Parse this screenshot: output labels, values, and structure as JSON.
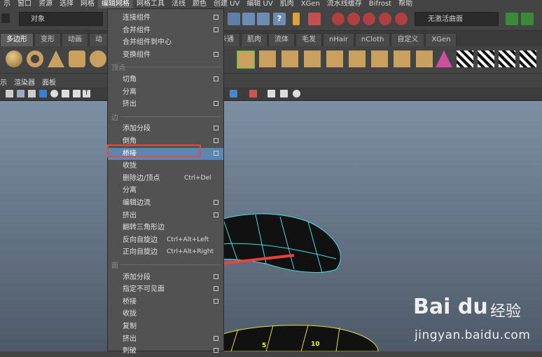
{
  "menubar": [
    "示",
    "窗口",
    "资源",
    "选择",
    "网格",
    "编辑网格",
    "网格工具",
    "法线",
    "颜色",
    "创建 UV",
    "编辑 UV",
    "肌肉",
    "XGen",
    "流水线缓存",
    "Bifrost",
    "帮助"
  ],
  "toolbar": {
    "object_mode": "对象",
    "smooth_mode": "无激活曲面"
  },
  "shelf_tabs": [
    "多边形",
    "变形",
    "动画",
    "动",
    "卡通",
    "肌肉",
    "流体",
    "毛发",
    "nHair",
    "nCloth",
    "自定义",
    "XGen"
  ],
  "panel_menu": [
    "示",
    "渲染器",
    "面板"
  ],
  "dropdown": {
    "top_items": [
      {
        "label": "连接组件",
        "box": true
      },
      {
        "label": "合并组件",
        "box": true
      },
      {
        "label": "合并组件到中心",
        "box": false
      },
      {
        "label": "变换组件",
        "box": true
      }
    ],
    "vertex_header": "顶点",
    "vertex_items": [
      {
        "label": "切角",
        "box": true
      },
      {
        "label": "分离",
        "box": false
      },
      {
        "label": "挤出",
        "box": true
      }
    ],
    "edge_header": "边",
    "edge_items": [
      {
        "label": "添加分段",
        "box": true
      },
      {
        "label": "倒角",
        "box": true
      },
      {
        "label": "桥接",
        "box": true,
        "highlight": true
      },
      {
        "label": "收拢",
        "box": false
      },
      {
        "label": "删除边/顶点",
        "shortcut": "Ctrl+Del"
      },
      {
        "label": "分离",
        "box": false
      },
      {
        "label": "编辑边流",
        "box": true
      },
      {
        "label": "挤出",
        "box": true
      },
      {
        "label": "翻转三角形边",
        "box": false
      },
      {
        "label": "反向自旋边",
        "shortcut": "Ctrl+Alt+Left"
      },
      {
        "label": "正向自旋边",
        "shortcut": "Ctrl+Alt+Right"
      }
    ],
    "face_header": "面",
    "face_items": [
      {
        "label": "添加分段",
        "box": true
      },
      {
        "label": "指定不可见面",
        "box": true
      },
      {
        "label": "桥接",
        "box": true
      },
      {
        "label": "收拢",
        "box": false
      },
      {
        "label": "复制",
        "box": false
      },
      {
        "label": "挤出",
        "box": true
      },
      {
        "label": "刺破",
        "box": true
      }
    ]
  },
  "viewport_labels": {
    "n5": "5",
    "n10": "10"
  },
  "watermark": {
    "brand": "Bai du",
    "jingyan": "经验",
    "url": "jingyan.baidu.com"
  }
}
